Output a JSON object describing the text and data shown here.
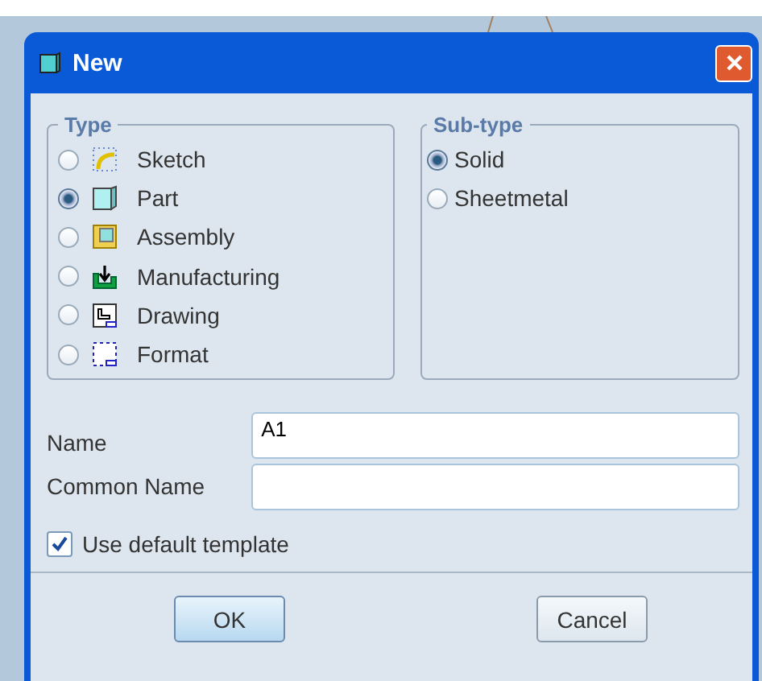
{
  "window": {
    "title": "New"
  },
  "type_group": {
    "title": "Type",
    "items": [
      {
        "label": "Sketch",
        "kind": "sketch",
        "selected": false
      },
      {
        "label": "Part",
        "kind": "part",
        "selected": true
      },
      {
        "label": "Assembly",
        "kind": "assembly",
        "selected": false
      },
      {
        "label": "Manufacturing",
        "kind": "manufacturing",
        "selected": false
      },
      {
        "label": "Drawing",
        "kind": "drawing",
        "selected": false
      },
      {
        "label": "Format",
        "kind": "format",
        "selected": false
      }
    ]
  },
  "subtype_group": {
    "title": "Sub-type",
    "items": [
      {
        "label": "Solid",
        "selected": true
      },
      {
        "label": "Sheetmetal",
        "selected": false
      }
    ]
  },
  "fields": [
    {
      "label": "Name",
      "value": "A1"
    },
    {
      "label": "Common Name"
    }
  ],
  "use_default_template": {
    "label": "Use default template",
    "checked": true
  },
  "buttons": [
    "OK",
    "Cancel"
  ]
}
